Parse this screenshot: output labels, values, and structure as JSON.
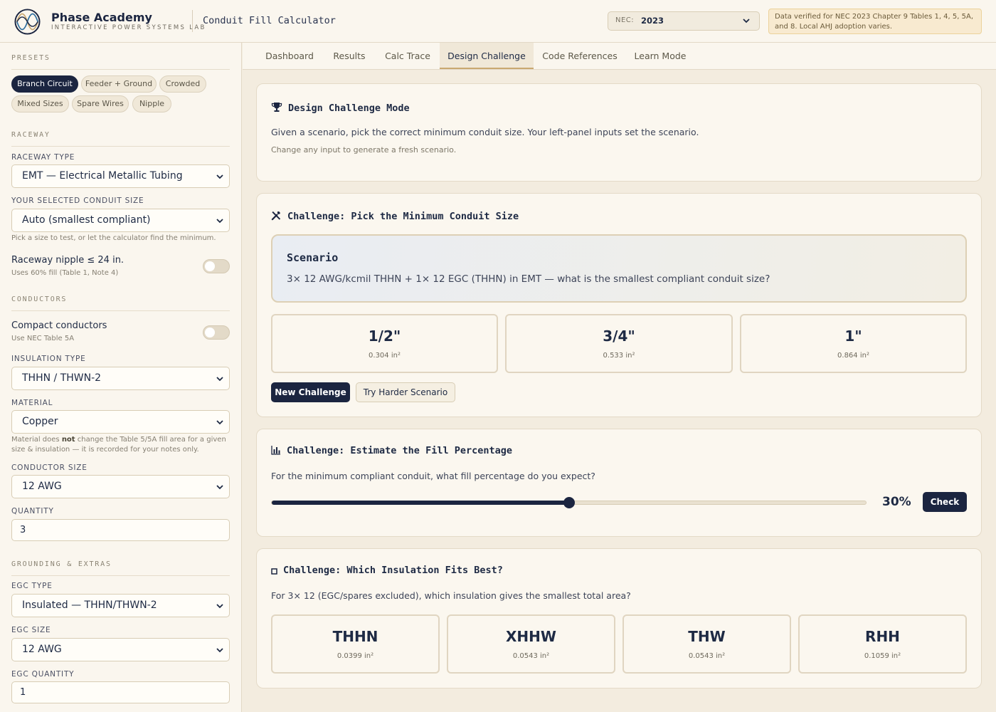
{
  "header": {
    "brand_name": "Phase Academy",
    "brand_sub": "INTERACTIVE POWER SYSTEMS LAB",
    "app_title": "Conduit Fill Calculator",
    "nec_label": "NEC:",
    "nec_value": "2023",
    "notice": "Data verified for NEC 2023 Chapter 9 Tables 1, 4, 5, 5A, and 8. Local AHJ adoption varies."
  },
  "sidebar": {
    "presets_heading": "PRESETS",
    "presets": [
      "Branch Circuit",
      "Feeder + Ground",
      "Crowded",
      "Mixed Sizes",
      "Spare Wires",
      "Nipple"
    ],
    "active_preset": "Branch Circuit",
    "raceway_heading": "RACEWAY",
    "raceway_type_label": "RACEWAY TYPE",
    "raceway_type_value": "EMT — Electrical Metallic Tubing",
    "conduit_size_label": "YOUR SELECTED CONDUIT SIZE",
    "conduit_size_value": "Auto (smallest compliant)",
    "conduit_size_hint": "Pick a size to test, or let the calculator find the minimum.",
    "nipple_title": "Raceway nipple ≤ 24 in.",
    "nipple_hint": "Uses 60% fill (Table 1, Note 4)",
    "nipple_on": false,
    "conductors_heading": "CONDUCTORS",
    "compact_title": "Compact conductors",
    "compact_hint": "Use NEC Table 5A",
    "compact_on": false,
    "insulation_label": "INSULATION TYPE",
    "insulation_value": "THHN / THWN-2",
    "material_label": "MATERIAL",
    "material_value": "Copper",
    "material_hint_a": "Material does ",
    "material_hint_b": "not",
    "material_hint_c": " change the Table 5/5A fill area for a given size & insulation — it is recorded for your notes only.",
    "conductor_size_label": "CONDUCTOR SIZE",
    "conductor_size_value": "12 AWG",
    "quantity_label": "QUANTITY",
    "quantity_value": "3",
    "grounding_heading": "GROUNDING & EXTRAS",
    "egc_type_label": "EGC TYPE",
    "egc_type_value": "Insulated — THHN/THWN-2",
    "egc_size_label": "EGC SIZE",
    "egc_size_value": "12 AWG",
    "egc_qty_label": "EGC QUANTITY",
    "egc_qty_value": "1"
  },
  "tabs": [
    "Dashboard",
    "Results",
    "Calc Trace",
    "Design Challenge",
    "Code References",
    "Learn Mode"
  ],
  "active_tab": "Design Challenge",
  "mode_card": {
    "title": "Design Challenge Mode",
    "text": "Given a scenario, pick the correct minimum conduit size. Your left-panel inputs set the scenario.",
    "sub": "Change any input to generate a fresh scenario."
  },
  "conduit_challenge": {
    "title": "Challenge: Pick the Minimum Conduit Size",
    "scenario_title": "Scenario",
    "scenario_text": "3× 12 AWG/kcmil THHN + 1× 12 EGC (THHN) in EMT — what is the smallest compliant conduit size?",
    "options": [
      {
        "size": "1/2\"",
        "area": "0.304 in²"
      },
      {
        "size": "3/4\"",
        "area": "0.533 in²"
      },
      {
        "size": "1\"",
        "area": "0.864 in²"
      }
    ],
    "new_button": "New Challenge",
    "harder_button": "Try Harder Scenario"
  },
  "fill_challenge": {
    "title": "Challenge: Estimate the Fill Percentage",
    "question": "For the minimum compliant conduit, what fill percentage do you expect?",
    "slider_fraction": 0.5,
    "value_label": "30%",
    "check_button": "Check"
  },
  "insulation_challenge": {
    "title": "Challenge: Which Insulation Fits Best?",
    "question": "For 3× 12 (EGC/spares excluded), which insulation gives the smallest total area?",
    "options": [
      {
        "name": "THHN",
        "area": "0.0399 in²"
      },
      {
        "name": "XHHW",
        "area": "0.0543 in²"
      },
      {
        "name": "THW",
        "area": "0.0543 in²"
      },
      {
        "name": "RHH",
        "area": "0.1059 in²"
      }
    ]
  },
  "colors": {
    "navy": "#1b2540",
    "cream": "#faf6ee",
    "background": "#f3ecdf",
    "notice_bg": "#f8ead0",
    "accent_gold": "#c9a870"
  },
  "icons": {
    "logo": "sine-wave-logo-icon",
    "mode": "trophy-icon",
    "conduit": "tools-icon",
    "fill": "bar-chart-icon",
    "insulation": "square-icon"
  }
}
